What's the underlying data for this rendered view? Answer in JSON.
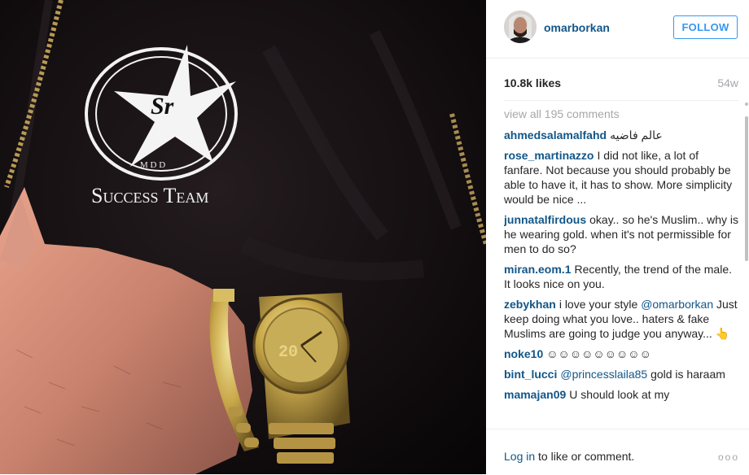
{
  "post": {
    "image_text": {
      "badge_letters": "Sr",
      "badge_sub": "M D D",
      "team": "Success Team",
      "watch_digits": "20"
    }
  },
  "header": {
    "username": "omarborkan",
    "follow_label": "FOLLOW"
  },
  "meta": {
    "likes": "10.8k likes",
    "age": "54w"
  },
  "comments": {
    "view_all": "view all 195 comments",
    "items": [
      {
        "user": "ahmedsalamalfahd",
        "text": "عالم فاضيه"
      },
      {
        "user": "rose_martinazzo",
        "text": "I did not like, a lot of fanfare. Not because you should probably be able to have it, it has to show. More simplicity would be nice ..."
      },
      {
        "user": "junnatalfirdous",
        "text": "okay.. so he's Muslim.. why is he wearing gold. when it's not permissible for men to do so?"
      },
      {
        "user": "miran.eom.1",
        "text": "Recently, the trend of the male. It looks nice on you."
      },
      {
        "user": "zebykhan",
        "pre": "i love your style ",
        "mention": "@omarborkan",
        "post": " Just keep doing what you love.. haters & fake Muslims are going to judge you anyway... 👆"
      },
      {
        "user": "noke10",
        "text": "☺☺☺☺☺☺☺☺☺"
      },
      {
        "user": "bint_lucci",
        "pre": "",
        "mention": "@princesslaila85",
        "post": " gold is haraam"
      },
      {
        "user": "mamajan09",
        "text": "U should look at my"
      }
    ]
  },
  "footer": {
    "login_link": "Log in",
    "login_rest": " to like or comment.",
    "more": "ooo"
  }
}
